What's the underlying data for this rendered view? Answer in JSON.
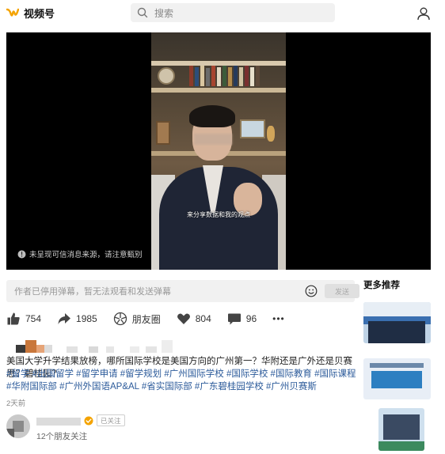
{
  "app": {
    "name": "视频号"
  },
  "search": {
    "placeholder": "搜索"
  },
  "video": {
    "subtitle": "来分享数据和我的观点",
    "notice": "未呈现可信消息来源，请注意甄别"
  },
  "danmu": {
    "placeholder": "作者已停用弹幕，暂无法观看和发送弹幕",
    "send_label": "发送"
  },
  "actions": {
    "likes": "754",
    "shares": "1985",
    "moments_label": "朋友圈",
    "hearts": "804",
    "comments": "96",
    "more": "•••"
  },
  "post": {
    "title": "美国大学升学结果放榜，哪所国际学校是美国方向的广州第一？华附还是广外还是贝赛思？碧桂园？",
    "tags": "#留学 #出国留学 #留学申请 #留学规划 #广州国际学校 #国际学校 #国际教育 #国际课程 #华附国际部 #广州外国语AP&AL #省实国际部 #广东碧桂园学校 #广州贝赛斯",
    "time": "2天前"
  },
  "author": {
    "follow_status": "已关注",
    "friends_following": "12个朋友关注"
  },
  "sidebar": {
    "title": "更多推荐"
  },
  "colors": {
    "accent": "#f4a300",
    "link": "#2b5a9a"
  }
}
